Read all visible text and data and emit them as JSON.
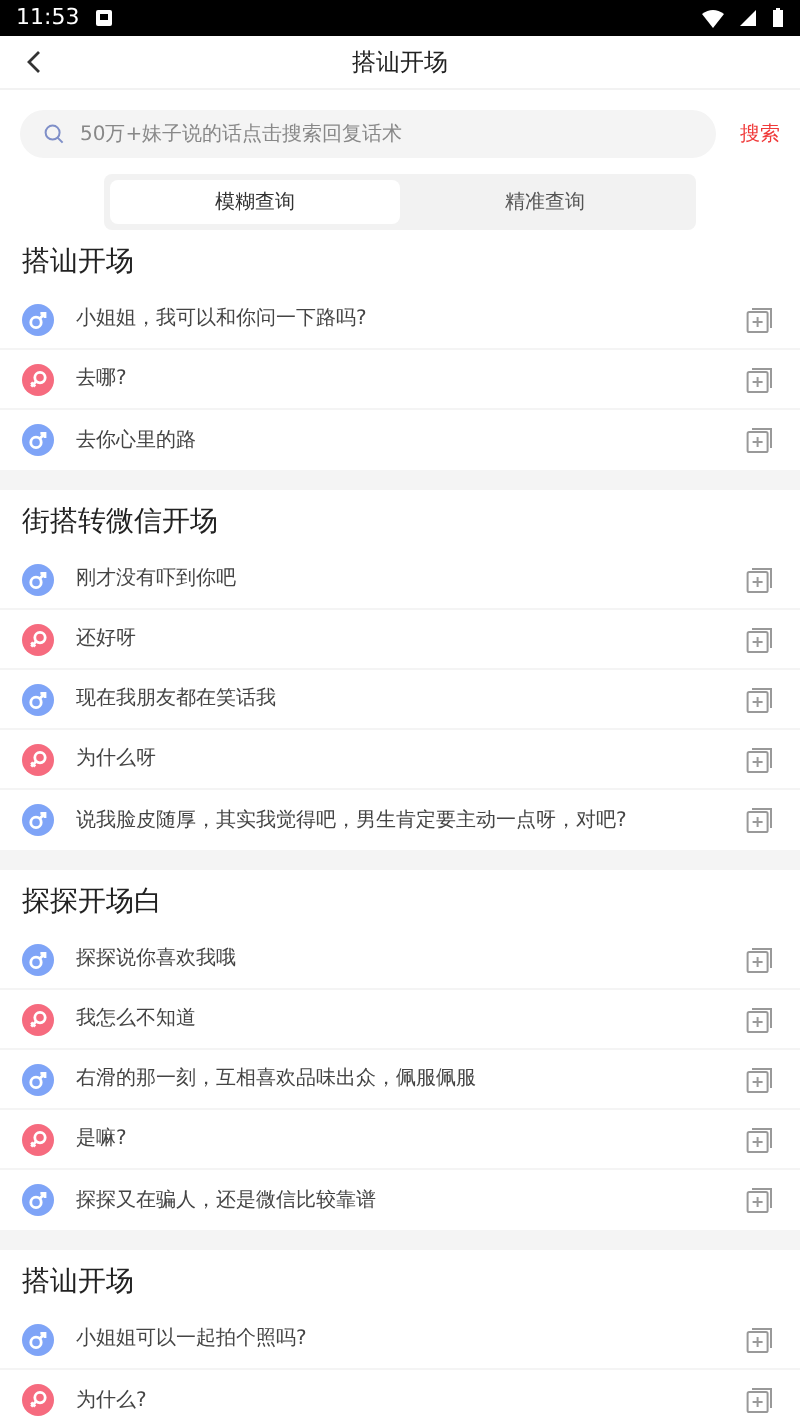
{
  "status_bar": {
    "time": "11:53"
  },
  "header": {
    "title": "搭讪开场"
  },
  "search": {
    "placeholder": "50万+妹子说的话点击搜索回复话术",
    "button": "搜索"
  },
  "tabs": [
    {
      "label": "模糊查询",
      "selected": true
    },
    {
      "label": "精准查询",
      "selected": false
    }
  ],
  "sections": [
    {
      "title": "搭讪开场",
      "items": [
        {
          "kind": "male",
          "text": "小姐姐，我可以和你问一下路吗?"
        },
        {
          "kind": "female",
          "text": "去哪?"
        },
        {
          "kind": "male",
          "text": "去你心里的路"
        }
      ]
    },
    {
      "title": "街搭转微信开场",
      "items": [
        {
          "kind": "male",
          "text": "刚才没有吓到你吧"
        },
        {
          "kind": "female",
          "text": "还好呀"
        },
        {
          "kind": "male",
          "text": "现在我朋友都在笑话我"
        },
        {
          "kind": "female",
          "text": "为什么呀"
        },
        {
          "kind": "male",
          "text": "说我脸皮随厚，其实我觉得吧，男生肯定要主动一点呀，对吧?"
        }
      ]
    },
    {
      "title": "探探开场白",
      "items": [
        {
          "kind": "male",
          "text": "探探说你喜欢我哦"
        },
        {
          "kind": "female",
          "text": "我怎么不知道"
        },
        {
          "kind": "male",
          "text": "右滑的那一刻，互相喜欢品味出众，佩服佩服"
        },
        {
          "kind": "female",
          "text": "是嘛?"
        },
        {
          "kind": "male",
          "text": "探探又在骗人，还是微信比较靠谱"
        }
      ]
    },
    {
      "title": "搭讪开场",
      "items": [
        {
          "kind": "male",
          "text": "小姐姐可以一起拍个照吗?"
        },
        {
          "kind": "female",
          "text": "为什么?"
        }
      ]
    }
  ]
}
